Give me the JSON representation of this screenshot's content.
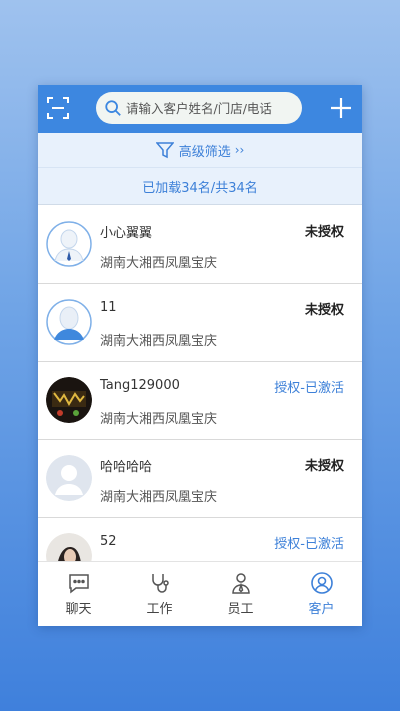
{
  "search": {
    "placeholder": "请输入客户姓名/门店/电话"
  },
  "filter": {
    "label": "高级筛选",
    "chevron": "››"
  },
  "loaded_text": "已加载34名/共34名",
  "customers": [
    {
      "name": "小心翼翼",
      "location": "湖南大湘西凤凰宝庆",
      "status": "未授权",
      "avatar": "default-male-avatar"
    },
    {
      "name": "11",
      "location": "湖南大湘西凤凰宝庆",
      "status": "未授权",
      "avatar": "default-female-avatar"
    },
    {
      "name": "Tang129000",
      "location": "湖南大湘西凤凰宝庆",
      "status": "授权-已激活",
      "avatar": "photo-avatar"
    },
    {
      "name": "哈哈哈哈",
      "location": "湖南大湘西凤凰宝庆",
      "status": "未授权",
      "avatar": "default-gray-avatar"
    },
    {
      "name": "52",
      "location": "",
      "status": "授权-已激活",
      "avatar": "photo-avatar"
    }
  ],
  "tabs": [
    {
      "label": "聊天",
      "icon": "chat-icon",
      "active": false
    },
    {
      "label": "工作",
      "icon": "stethoscope-icon",
      "active": false
    },
    {
      "label": "员工",
      "icon": "staff-icon",
      "active": false
    },
    {
      "label": "客户",
      "icon": "customer-icon",
      "active": true
    }
  ],
  "colors": {
    "primary": "#3d87e0",
    "accent_text": "#3d80d8",
    "filter_bg": "#e8f1fc"
  }
}
